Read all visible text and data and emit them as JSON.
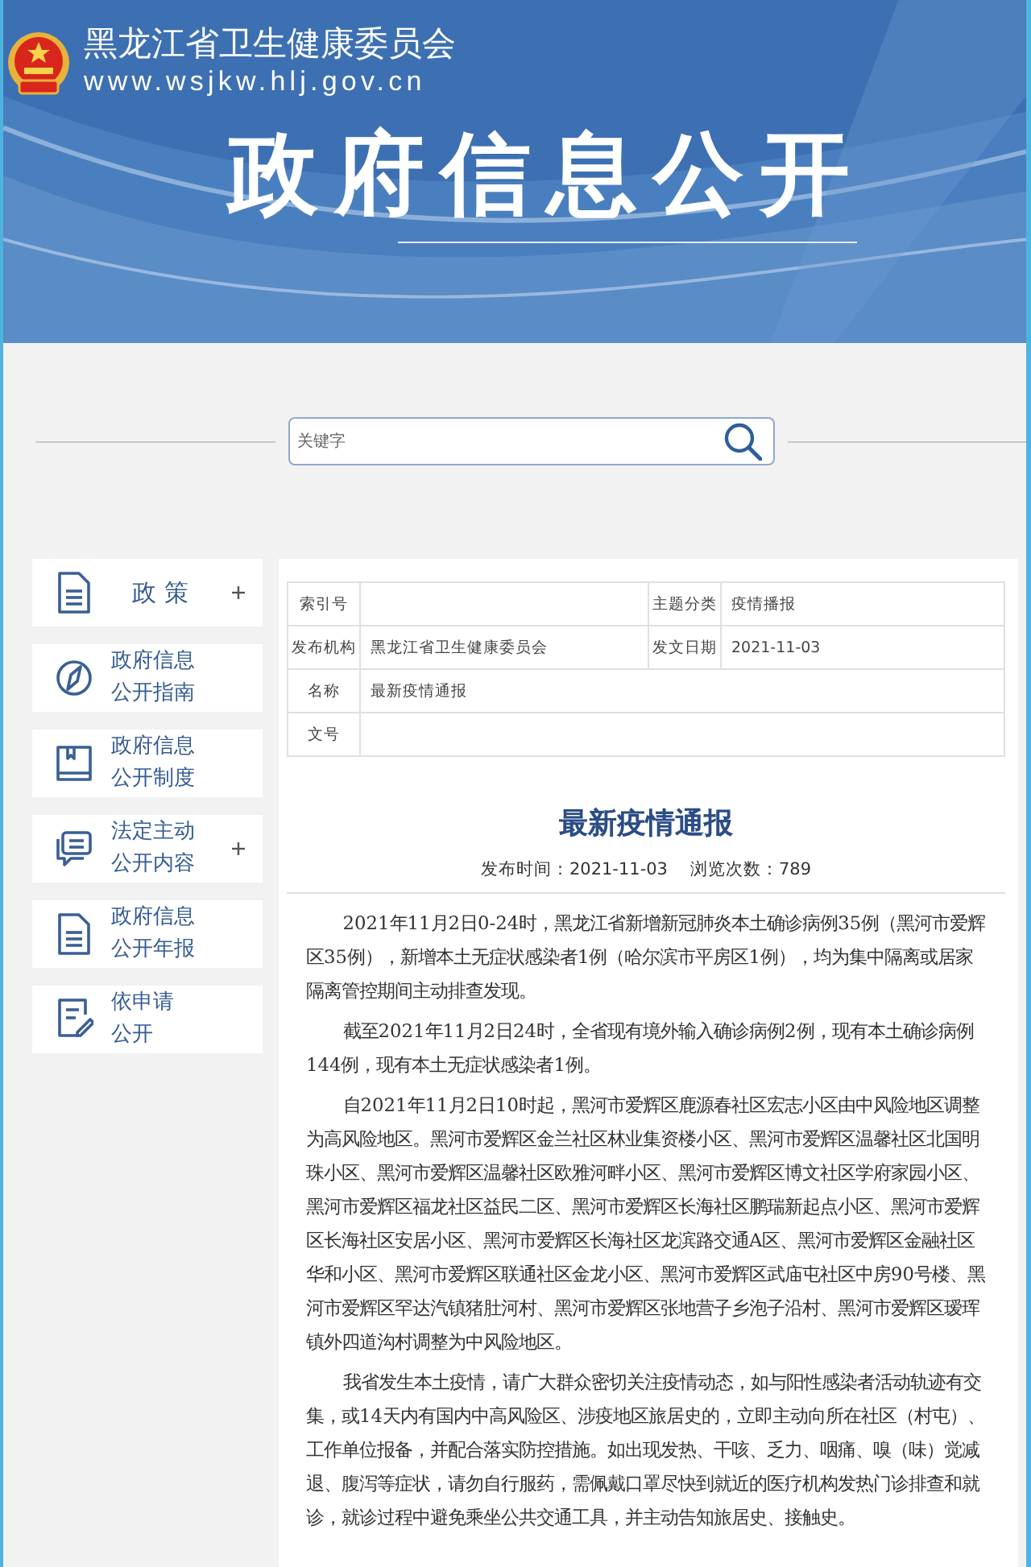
{
  "header": {
    "site_name": "黑龙江省卫生健康委员会",
    "site_url": "www.wsjkw.hlj.gov.cn",
    "banner_title": "政府信息公开"
  },
  "search": {
    "placeholder": "关键字"
  },
  "sidebar": {
    "items": [
      {
        "label_lines": [
          "政 策"
        ],
        "expandable": true
      },
      {
        "label_lines": [
          "政府信息",
          "公开指南"
        ],
        "expandable": false
      },
      {
        "label_lines": [
          "政府信息",
          "公开制度"
        ],
        "expandable": false
      },
      {
        "label_lines": [
          "法定主动",
          "公开内容"
        ],
        "expandable": true
      },
      {
        "label_lines": [
          "政府信息",
          "公开年报"
        ],
        "expandable": false
      },
      {
        "label_lines": [
          "依申请",
          "公开"
        ],
        "expandable": false
      }
    ]
  },
  "info_table": {
    "rows": [
      {
        "fields": [
          {
            "label": "索引号"
          },
          {
            "label": "主题分类",
            "value": "疫情播报"
          }
        ]
      },
      {
        "fields": [
          {
            "label": "发布机构",
            "value": "黑龙江省卫生健康委员会"
          },
          {
            "label": "发文日期",
            "value": "2021-11-03"
          }
        ]
      },
      {
        "fields": [
          {
            "label": "名称",
            "value": "最新疫情通报"
          }
        ]
      },
      {
        "fields": [
          {
            "label": "文号"
          }
        ]
      }
    ]
  },
  "article": {
    "title": "最新疫情通报",
    "publish_time": "发布时间：2021-11-03",
    "views": "浏览次数：789",
    "paragraphs": [
      "2021年11月2日0-24时，黑龙江省新增新冠肺炎本土确诊病例35例（黑河市爱辉区35例），新增本土无症状感染者1例（哈尔滨市平房区1例），均为集中隔离或居家隔离管控期间主动排查发现。",
      "截至2021年11月2日24时，全省现有境外输入确诊病例2例，现有本土确诊病例144例，现有本土无症状感染者1例。",
      "自2021年11月2日10时起，黑河市爱辉区鹿源春社区宏志小区由中风险地区调整为高风险地区。黑河市爱辉区金兰社区林业集资楼小区、黑河市爱辉区温馨社区北国明珠小区、黑河市爱辉区温馨社区欧雅河畔小区、黑河市爱辉区博文社区学府家园小区、黑河市爱辉区福龙社区益民二区、黑河市爱辉区长海社区鹏瑞新起点小区、黑河市爱辉区长海社区安居小区、黑河市爱辉区长海社区龙滨路交通A区、黑河市爱辉区金融社区华和小区、黑河市爱辉区联通社区金龙小区、黑河市爱辉区武庙屯社区中房90号楼、黑河市爱辉区罕达汽镇猪肚河村、黑河市爱辉区张地营子乡泡子沿村、黑河市爱辉区瑷珲镇外四道沟村调整为中风险地区。",
      "我省发生本土疫情，请广大群众密切关注疫情动态，如与阳性感染者活动轨迹有交集，或14天内有国内中高风险区、涉疫地区旅居史的，立即主动向所在社区（村屯）、工作单位报备，并配合落实防控措施。如出现发热、干咳、乏力、咽痛、嗅（味）觉减退、腹泻等症状，请勿自行服药，需佩戴口罩尽快到就近的医疗机构发热门诊排查和就诊，就诊过程中避免乘坐公共交通工具，并主动告知旅居史、接触史。"
    ]
  }
}
